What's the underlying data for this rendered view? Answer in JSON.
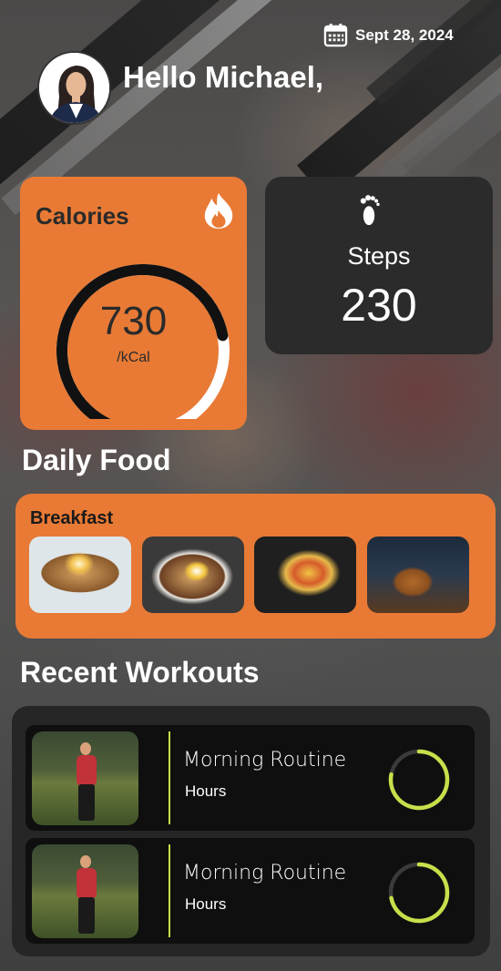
{
  "header": {
    "date": "Sept 28, 2024",
    "greeting": "Hello Michael,",
    "icons": {
      "calendar": "calendar-icon",
      "avatar": "user-avatar"
    }
  },
  "calories": {
    "title": "Calories",
    "value": "730",
    "unit": "/kCal",
    "progress_fraction": 0.72,
    "icon": "flame-icon",
    "accent_color": "#e87a35"
  },
  "steps": {
    "label": "Steps",
    "value": "230",
    "icon": "footprint-icon"
  },
  "daily_food": {
    "heading": "Daily Food",
    "meal_label": "Breakfast",
    "items": [
      "avocado-egg-toast",
      "fried-egg-toast-plate",
      "frittata-skillet",
      "pancake-stack"
    ]
  },
  "recent_workouts": {
    "heading": "Recent Workouts",
    "items": [
      {
        "title": "Morning Routine",
        "subtitle": "Hours",
        "progress_fraction": 0.78
      },
      {
        "title": "Morning Routine",
        "subtitle": "Hours",
        "progress_fraction": 0.72
      }
    ],
    "ring_color": "#c6e04a"
  }
}
